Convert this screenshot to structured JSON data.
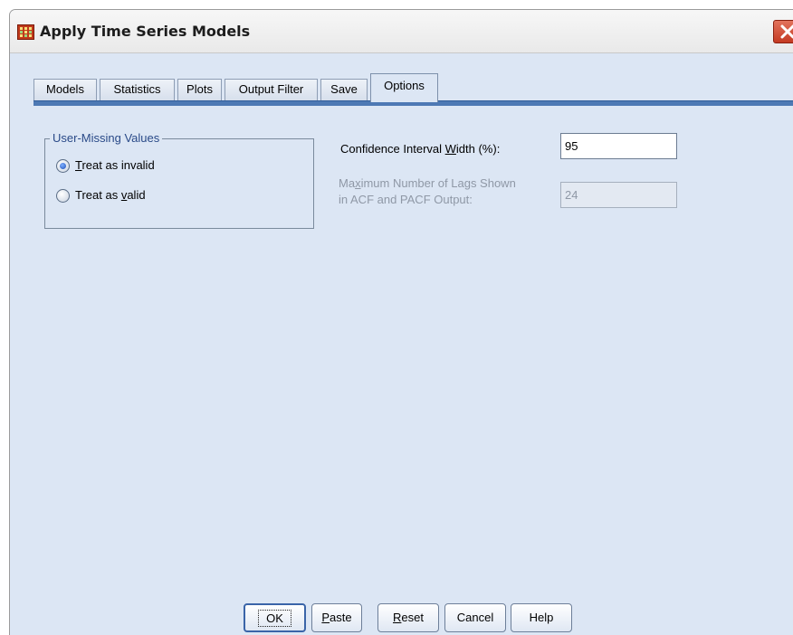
{
  "window": {
    "title": "Apply Time Series Models",
    "app_icon": "spss-grid-icon",
    "close_icon": "close-icon"
  },
  "tabs": [
    {
      "label": "Models",
      "active": false
    },
    {
      "label": "Statistics",
      "active": false
    },
    {
      "label": "Plots",
      "active": false
    },
    {
      "label": "Output Filter",
      "active": false
    },
    {
      "label": "Save",
      "active": false
    },
    {
      "label": "Options",
      "active": true
    }
  ],
  "user_missing": {
    "legend": "User-Missing Values",
    "options": [
      {
        "pre": "",
        "mnemonic": "T",
        "post": "reat as invalid",
        "selected": true
      },
      {
        "pre": "Treat as ",
        "mnemonic": "v",
        "post": "alid",
        "selected": false
      }
    ]
  },
  "confidence": {
    "label_pre": "Confidence Interval ",
    "label_mnemonic": "W",
    "label_post": "idth (%):",
    "value": "95"
  },
  "max_lags": {
    "label_line1_pre": "Ma",
    "label_line1_mnemonic": "x",
    "label_line1_post": "imum Number of Lags Shown",
    "label_line2": "in ACF and PACF Output:",
    "value": "24",
    "enabled": false
  },
  "buttons": {
    "ok": "OK",
    "paste_mnemonic": "P",
    "paste_rest": "aste",
    "reset_mnemonic": "R",
    "reset_rest": "eset",
    "cancel": "Cancel",
    "help": "Help"
  },
  "colors": {
    "dialog_bg": "#dce6f4",
    "tab_underline": "#4d79b4",
    "legend_text": "#2a4a88",
    "close_button": "#c43a22"
  }
}
